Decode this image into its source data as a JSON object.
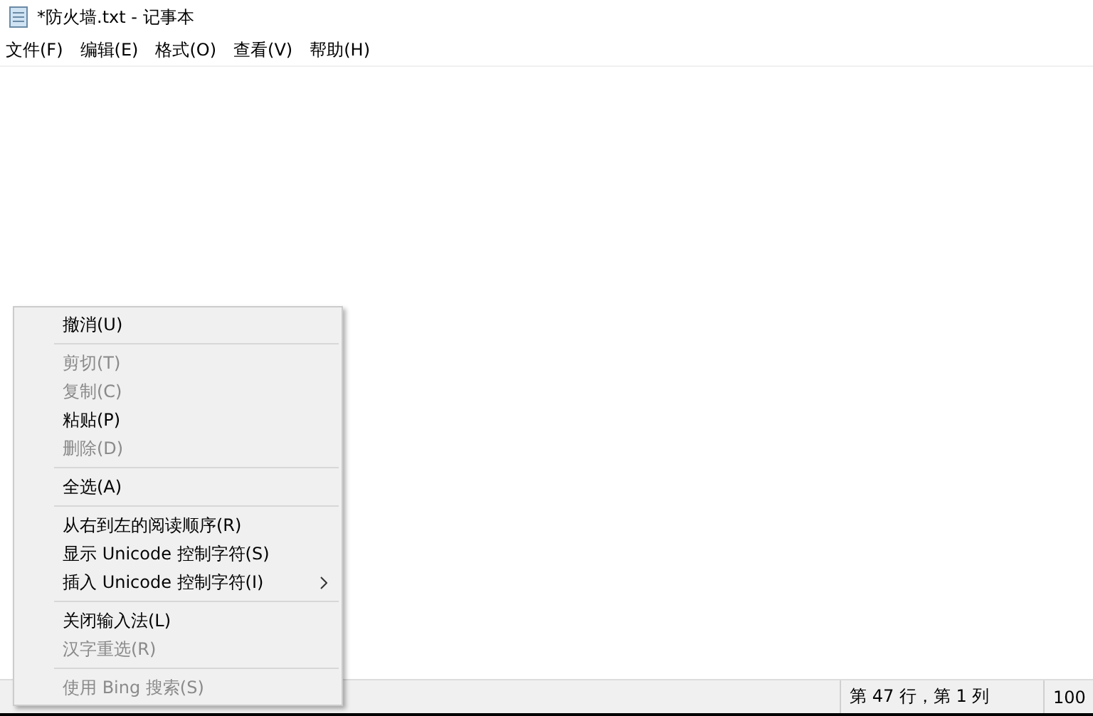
{
  "window": {
    "title": "*防火墙.txt - 记事本"
  },
  "menu_bar": [
    "文件(F)",
    "编辑(E)",
    "格式(O)",
    "查看(V)",
    "帮助(H)"
  ],
  "context_menu": [
    {
      "kind": "item",
      "label": "撤消(U)",
      "disabled": false,
      "submenu": false
    },
    {
      "kind": "separator"
    },
    {
      "kind": "item",
      "label": "剪切(T)",
      "disabled": true,
      "submenu": false
    },
    {
      "kind": "item",
      "label": "复制(C)",
      "disabled": true,
      "submenu": false
    },
    {
      "kind": "item",
      "label": "粘贴(P)",
      "disabled": false,
      "submenu": false
    },
    {
      "kind": "item",
      "label": "删除(D)",
      "disabled": true,
      "submenu": false
    },
    {
      "kind": "separator"
    },
    {
      "kind": "item",
      "label": "全选(A)",
      "disabled": false,
      "submenu": false
    },
    {
      "kind": "separator"
    },
    {
      "kind": "item",
      "label": "从右到左的阅读顺序(R)",
      "disabled": false,
      "submenu": false
    },
    {
      "kind": "item",
      "label": "显示 Unicode 控制字符(S)",
      "disabled": false,
      "submenu": false
    },
    {
      "kind": "item",
      "label": "插入 Unicode 控制字符(I)",
      "disabled": false,
      "submenu": true
    },
    {
      "kind": "separator"
    },
    {
      "kind": "item",
      "label": "关闭输入法(L)",
      "disabled": false,
      "submenu": false
    },
    {
      "kind": "item",
      "label": "汉字重选(R)",
      "disabled": true,
      "submenu": false
    },
    {
      "kind": "separator"
    },
    {
      "kind": "item",
      "label": "使用 Bing 搜索(S)",
      "disabled": true,
      "submenu": false
    }
  ],
  "status_bar": {
    "position": "第 47 行，第 1 列",
    "zoom": "100"
  }
}
